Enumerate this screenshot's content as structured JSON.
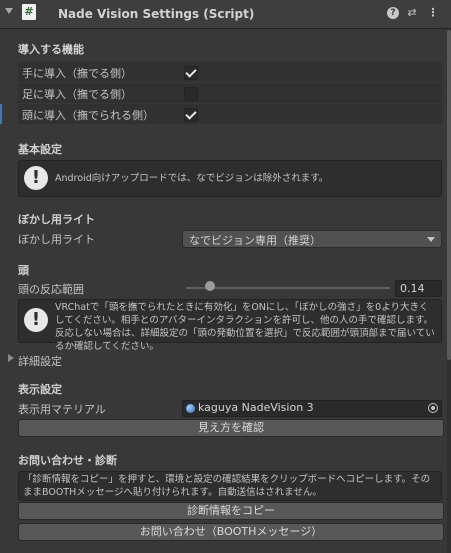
{
  "header": {
    "title": "Nade Vision Settings (Script)",
    "script_glyph": "#",
    "help_glyph": "?",
    "preset_glyph": "⇄",
    "menu_glyph": "⋮"
  },
  "feature_section": {
    "title": "導入する機能",
    "items": [
      {
        "label": "手に導入（撫でる側）",
        "checked": true
      },
      {
        "label": "足に導入（撫でる側）",
        "checked": false
      },
      {
        "label": "頭に導入（撫でられる側）",
        "checked": true
      }
    ]
  },
  "basic_section": {
    "title": "基本設定",
    "help": "Android向けアップロードでは、なでビジョンは除外されます。"
  },
  "blur_light_section": {
    "title": "ぼかし用ライト",
    "field_label": "ぼかし用ライト",
    "selected_option": "なでビジョン専用（推奨）"
  },
  "head_section": {
    "title": "頭",
    "field_label": "頭の反応範囲",
    "value": "0.14",
    "slider_fraction": 0.12,
    "help": "VRChatで「頭を撫でられたときに有効化」をONにし、「ぼかしの強さ」を0より大きくしてください。相手とのアバターインタラクションを許可し、他の人の手で確認します。反応しない場合は、詳細設定の「頭の発動位置を選択」で反応範囲が頭頂部まで届いているか確認してください。"
  },
  "advanced_foldout": {
    "label": "詳細設定"
  },
  "display_section": {
    "title": "表示設定",
    "field_label": "表示用マテリアル",
    "material_name": "kaguya NadeVision 3",
    "preview_button": "見え方を確認"
  },
  "contact_section": {
    "title": "お問い合わせ・診断",
    "info": "「診断情報をコピー」を押すと、環境と設定の確認結果をクリップボードへコピーします。そのままBOOTHメッセージへ貼り付けられます。自動送信はされません。",
    "copy_button": "診断情報をコピー",
    "contact_button": "お問い合わせ（BOOTHメッセージ）"
  },
  "colors": {
    "background": "#383838",
    "selection_marker": "#3a79bb"
  }
}
